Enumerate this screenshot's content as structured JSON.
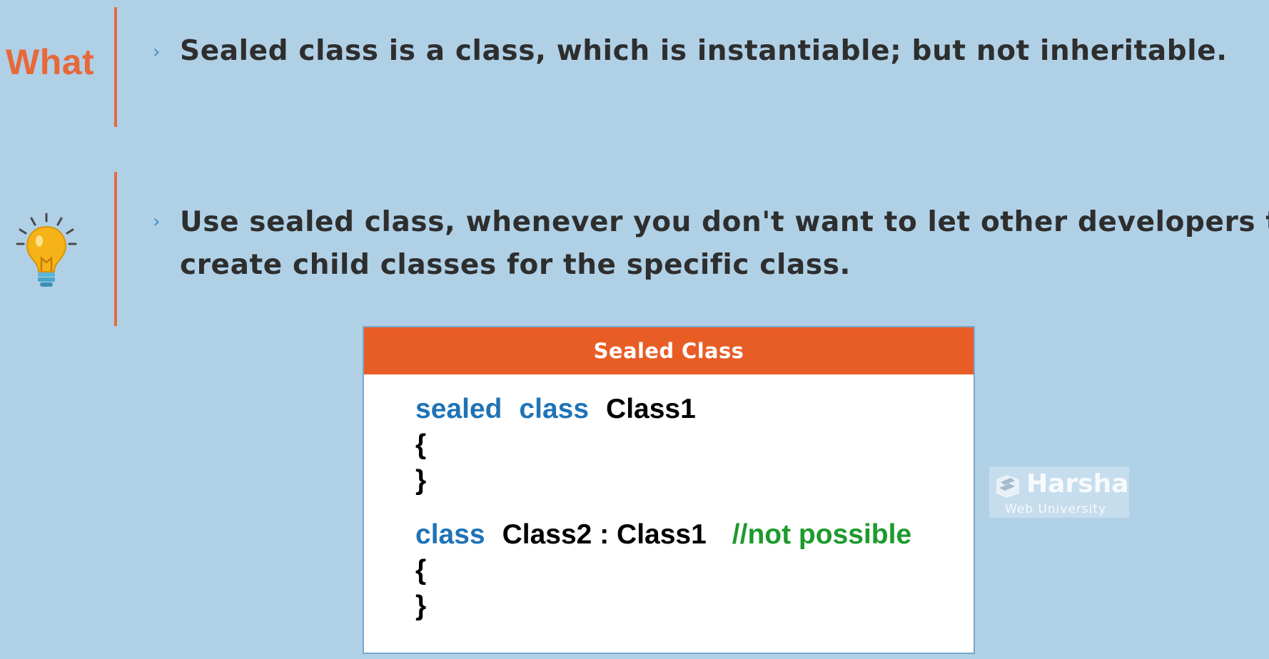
{
  "section": {
    "label": "What",
    "bullet_symbol": "›"
  },
  "points": [
    {
      "text": "Sealed class is a class, which is instantiable; but not inheritable."
    },
    {
      "line1": "Use sealed class, whenever you don't want to let other developers to",
      "line2": "create child classes for the specific class."
    }
  ],
  "icons": {
    "tip": "lightbulb-icon"
  },
  "code_box": {
    "title": "Sealed Class",
    "line1": {
      "kw1": "sealed",
      "kw2": "class",
      "name": "Class1"
    },
    "open_brace": "{",
    "close_brace": "}",
    "line2": {
      "kw": "class",
      "code": "Class2 : Class1",
      "comment": "//not possible"
    }
  },
  "watermark": {
    "name": "Harsha",
    "subtitle": "Web University"
  },
  "colors": {
    "background": "#b0d0e6",
    "accent": "#e8683a",
    "header": "#e85d26",
    "keyword": "#1f73b7",
    "comment": "#1d9a2c"
  }
}
